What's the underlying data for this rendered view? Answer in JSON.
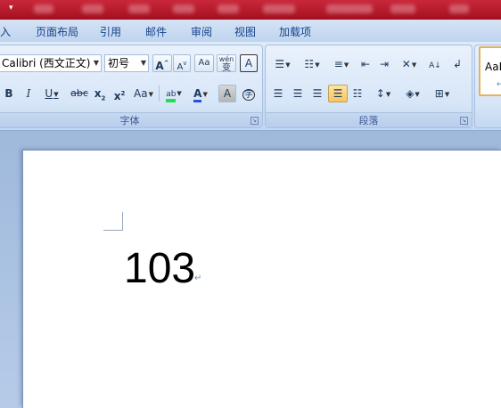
{
  "title_bar": {
    "quick_access_symbol": "▾"
  },
  "tabs": [
    "入",
    "页面布局",
    "引用",
    "邮件",
    "审阅",
    "视图",
    "加载项"
  ],
  "font_group": {
    "label": "字体",
    "font_name": "Calibri (西文正文)",
    "font_size": "初号",
    "grow_font": "A",
    "shrink_font": "A",
    "clear_format": "Aa",
    "phonetic": "wén",
    "border_char": "A",
    "bold": "B",
    "italic": "I",
    "underline": "U",
    "strikethrough": "abc",
    "subscript": "x",
    "superscript": "x",
    "change_case": "Aa",
    "highlight": "ab",
    "font_color": "A",
    "shade_char": "A",
    "enclose_char": "字"
  },
  "paragraph_group": {
    "label": "段落"
  },
  "styles": {
    "preview": "AaB",
    "mark": "↵"
  },
  "document": {
    "text": "103",
    "paragraph_mark": "↵"
  }
}
